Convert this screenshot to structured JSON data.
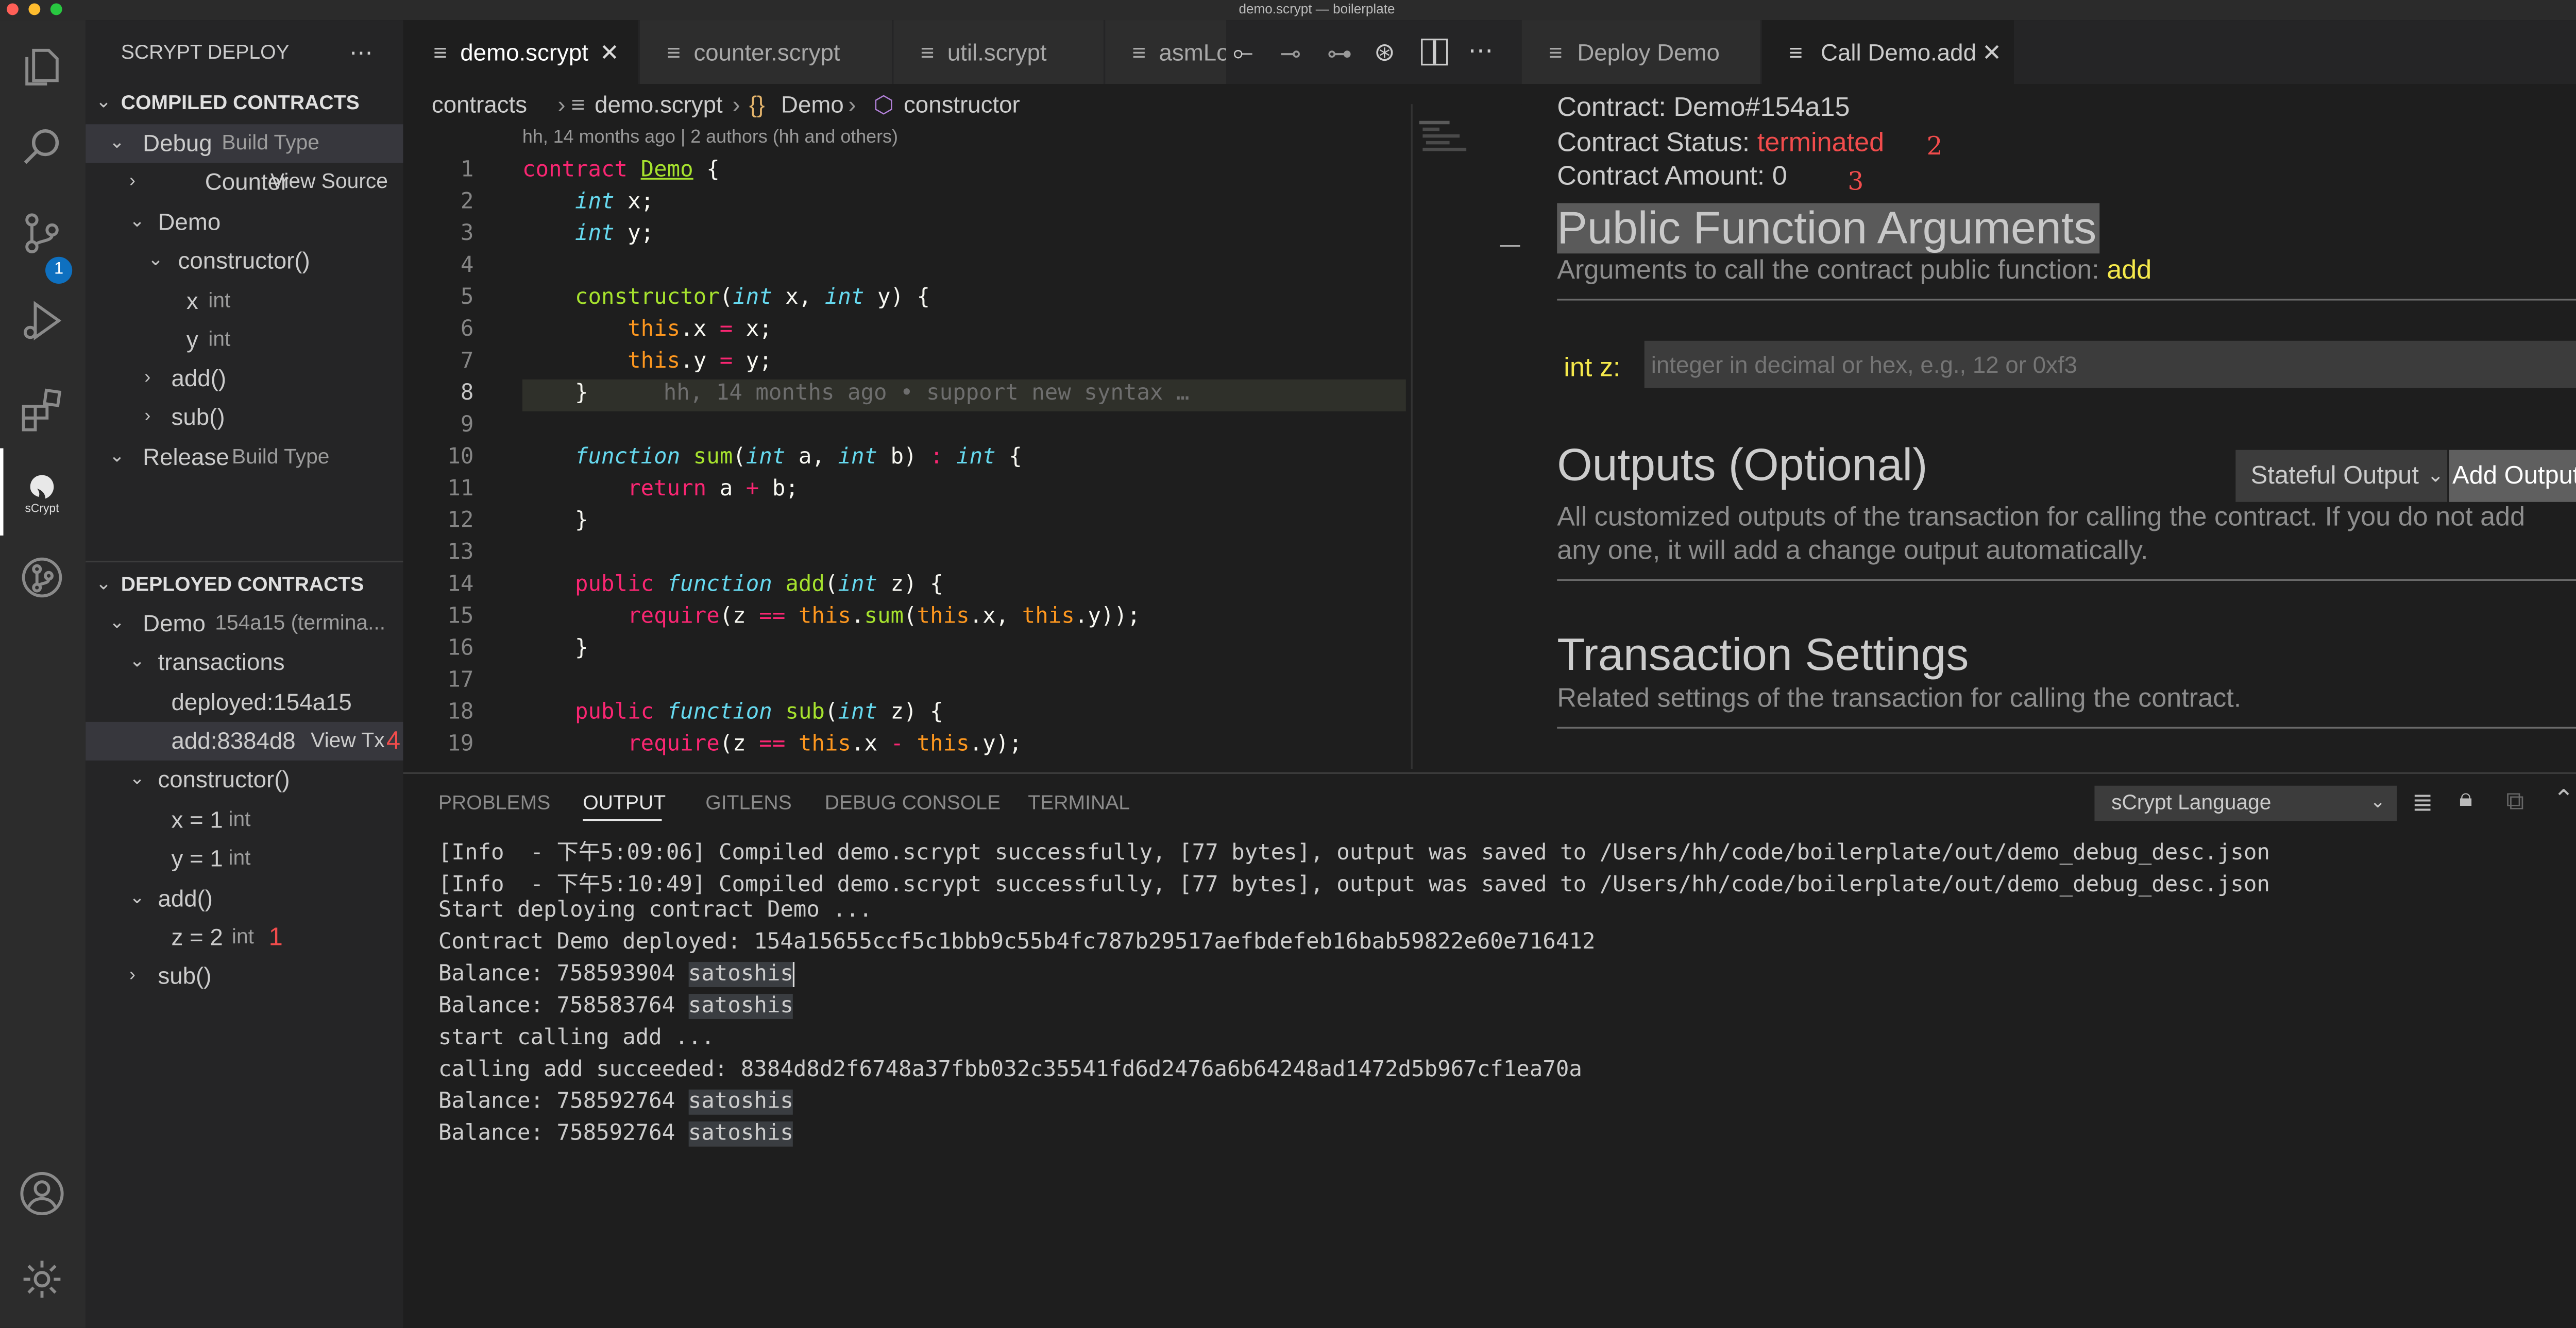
{
  "window_title": "demo.scrypt — boilerplate",
  "sidebar": {
    "title": "SCRYPT DEPLOY",
    "more": "⋯",
    "compiled_header": "COMPILED CONTRACTS",
    "debug_label": "Debug",
    "build_type": "Build Type",
    "counter": "Counter",
    "view_source": "View Source",
    "demo": "Demo",
    "constructor": "constructor()",
    "param_x": "x",
    "param_y": "y",
    "type_int": "int",
    "add": "add()",
    "sub": "sub()",
    "release_label": "Release",
    "deployed_header": "DEPLOYED CONTRACTS",
    "deployed_demo": "Demo",
    "deployed_demo_detail": "154a15 (termina...",
    "transactions": "transactions",
    "tx_deployed": "deployed:154a15",
    "tx_add": "add:8384d8",
    "view_tx": "View Tx",
    "marker_4": "4",
    "d_constructor": "constructor()",
    "d_x": "x = 1",
    "d_y": "y = 1",
    "d_add": "add()",
    "d_z": "z = 2",
    "marker_1": "1",
    "d_sub": "sub()",
    "scm_badge": "1",
    "scrypt_label": "sCrypt"
  },
  "editor": {
    "tabs": [
      "demo.scrypt",
      "counter.scrypt",
      "util.scrypt",
      "asmLo"
    ],
    "breadcrumb": [
      "contracts",
      "demo.scrypt",
      "Demo",
      "constructor"
    ],
    "blame_header": "hh, 14 months ago | 2 authors (hh and others)",
    "inline_blame": "hh, 14 months ago • support new syntax …",
    "line_numbers": [
      "1",
      "2",
      "3",
      "4",
      "5",
      "6",
      "7",
      "8",
      "9",
      "10",
      "11",
      "12",
      "13",
      "14",
      "15",
      "16",
      "17",
      "18",
      "19"
    ]
  },
  "right_panel": {
    "tabs": [
      "Deploy Demo",
      "Call Demo.add"
    ],
    "contract_label": "Contract: Demo#154a15",
    "status_label": "Contract Status:",
    "status_value": "terminated",
    "marker_2": "2",
    "amount_label": "Contract Amount: 0",
    "marker_3": "3",
    "args_heading": "Public Function Arguments",
    "args_desc": "Arguments to call the contract public function:",
    "args_fn": "add",
    "int_z_label": "int z:",
    "int_z_placeholder": "integer in decimal or hex, e.g., 12 or 0xf3",
    "outputs_heading": "Outputs (Optional)",
    "output_select": "Stateful Output",
    "add_output": "Add Output",
    "outputs_desc_1": "All customized outputs of the transaction for calling the contract. If you do not add",
    "outputs_desc_2": "any one, it will add a change output automatically.",
    "tx_heading": "Transaction Settings",
    "tx_desc": "Related settings of the transaction for calling the contract."
  },
  "bottom": {
    "tabs": [
      "PROBLEMS",
      "OUTPUT",
      "GITLENS",
      "DEBUG CONSOLE",
      "TERMINAL"
    ],
    "channel": "sCrypt Language",
    "lines": [
      "[Info  - 下午5:09:06] Compiled demo.scrypt successfully, [77 bytes], output was saved to /Users/hh/code/boilerplate/out/demo_debug_desc.json",
      "[Info  - 下午5:10:49] Compiled demo.scrypt successfully, [77 bytes], output was saved to /Users/hh/code/boilerplate/out/demo_debug_desc.json",
      "Start deploying contract Demo ...",
      "Contract Demo deployed: 154a15655ccf5c1bbb9c55b4fc787b29517aefbdefeb16bab59822e60e716412",
      "Balance: 758593904 ",
      "Balance: 758583764 ",
      "start calling add ...",
      "calling add succeeded: 8384d8d2f6748a37fbb032c35541fd6d2476a6b64248ad1472d5b967cf1ea70a",
      "Balance: 758592764 ",
      "Balance: 758592764 "
    ],
    "satoshis": "satoshis"
  },
  "colors": {
    "accent_red": "#f14c4c",
    "accent_yellow": "#f5e94b",
    "badge_blue": "#0e70c0"
  }
}
